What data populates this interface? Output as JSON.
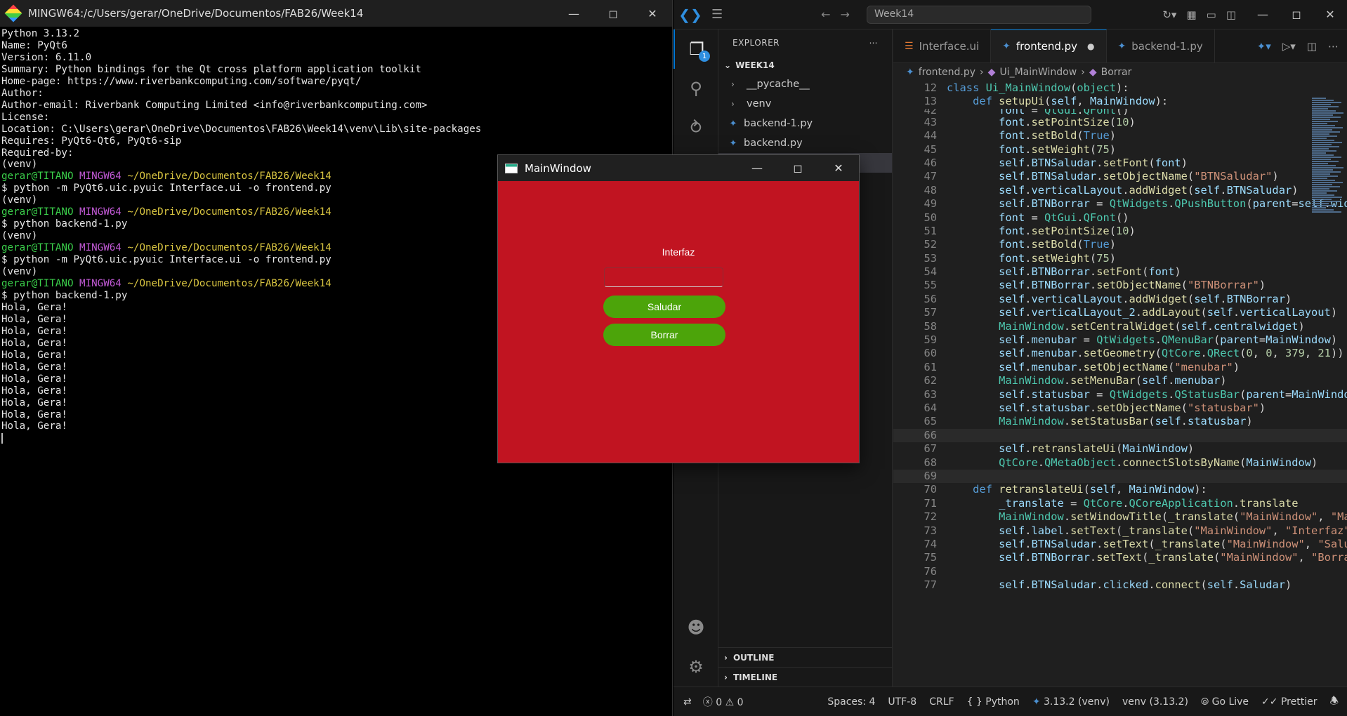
{
  "terminal": {
    "title": "MINGW64:/c/Users/gerar/OneDrive/Documentos/FAB26/Week14",
    "info_lines": [
      "Python 3.13.2",
      "Name: PyQt6",
      "Version: 6.11.0",
      "Summary: Python bindings for the Qt cross platform application toolkit",
      "Home-page: https://www.riverbankcomputing.com/software/pyqt/",
      "Author:",
      "Author-email: Riverbank Computing Limited <info@riverbankcomputing.com>",
      "License:",
      "Location: C:\\Users\\gerar\\OneDrive\\Documentos\\FAB26\\Week14\\venv\\Lib\\site-packages",
      "Requires: PyQt6-Qt6, PyQt6-sip",
      "Required-by:",
      "(venv)"
    ],
    "prompt_user": "gerar@TITANO",
    "prompt_shell": "MINGW64",
    "prompt_path": "~/OneDrive/Documentos/FAB26/Week14",
    "venv": "(venv)",
    "cmd1": "$ python -m PyQt6.uic.pyuic Interface.ui -o frontend.py",
    "cmd2": "$ python backend-1.py",
    "cmd3": "$ python -m PyQt6.uic.pyuic Interface.ui -o frontend.py",
    "cmd4": "$ python backend-1.py",
    "output_line": "Hola, Gera!",
    "output_count": 11
  },
  "vscode": {
    "search_text": "Week14",
    "explorer_label": "EXPLORER",
    "explorer_badge": "1",
    "folder": "WEEK14",
    "tree": [
      {
        "type": "folder",
        "label": "__pycache__"
      },
      {
        "type": "folder",
        "label": "venv"
      },
      {
        "type": "file",
        "label": "backend-1.py"
      },
      {
        "type": "file",
        "label": "backend.py"
      }
    ],
    "outline_label": "OUTLINE",
    "timeline_label": "TIMELINE",
    "tabs": [
      {
        "label": "Interface.ui",
        "active": false
      },
      {
        "label": "frontend.py",
        "active": true
      },
      {
        "label": "backend-1.py",
        "active": false
      }
    ],
    "breadcrumb": {
      "file": "frontend.py",
      "cls": "Ui_MainWindow",
      "method": "Borrar"
    },
    "status": {
      "errors": "0",
      "warnings": "0",
      "spaces": "Spaces: 4",
      "encoding": "UTF-8",
      "eol": "CRLF",
      "language": "Python",
      "interpreter": "3.13.2 (venv)",
      "env": "venv (3.13.2)",
      "golive": "Go Live",
      "prettier": "Prettier"
    }
  },
  "code_lines": [
    {
      "n": "12",
      "html": "<span class='kw'>class</span> <span class='cls'>Ui_MainWindow</span>(<span class='cls'>object</span>):",
      "cls": "sticky"
    },
    {
      "n": "13",
      "html": "    <span class='kw'>def</span> <span class='fn'>setupUi</span>(<span class='self'>self</span>, <span class='self'>MainWindow</span>):",
      "cls": "sticky"
    },
    {
      "n": "42",
      "html": "        <span class='self'>font</span> = <span class='cls'>QtGui</span>.<span class='cls'>QFont</span>()",
      "cls": "clip"
    },
    {
      "n": "43",
      "html": "        <span class='self'>font</span>.<span class='fn'>setPointSize</span>(<span class='num'>10</span>)"
    },
    {
      "n": "44",
      "html": "        <span class='self'>font</span>.<span class='fn'>setBold</span>(<span class='kw'>True</span>)"
    },
    {
      "n": "45",
      "html": "        <span class='self'>font</span>.<span class='fn'>setWeight</span>(<span class='num'>75</span>)"
    },
    {
      "n": "46",
      "html": "        <span class='self'>self</span>.<span class='self'>BTNSaludar</span>.<span class='fn'>setFont</span>(<span class='self'>font</span>)"
    },
    {
      "n": "47",
      "html": "        <span class='self'>self</span>.<span class='self'>BTNSaludar</span>.<span class='fn'>setObjectName</span>(<span class='str'>\"BTNSaludar\"</span>)"
    },
    {
      "n": "48",
      "html": "        <span class='self'>self</span>.<span class='self'>verticalLayout</span>.<span class='fn'>addWidget</span>(<span class='self'>self</span>.<span class='self'>BTNSaludar</span>)"
    },
    {
      "n": "49",
      "html": "        <span class='self'>self</span>.<span class='self'>BTNBorrar</span> = <span class='cls'>QtWidgets</span>.<span class='cls'>QPushButton</span>(<span class='self'>parent</span>=<span class='self'>self</span>.<span class='self'>widget</span>)"
    },
    {
      "n": "50",
      "html": "        <span class='self'>font</span> = <span class='cls'>QtGui</span>.<span class='cls'>QFont</span>()"
    },
    {
      "n": "51",
      "html": "        <span class='self'>font</span>.<span class='fn'>setPointSize</span>(<span class='num'>10</span>)"
    },
    {
      "n": "52",
      "html": "        <span class='self'>font</span>.<span class='fn'>setBold</span>(<span class='kw'>True</span>)"
    },
    {
      "n": "53",
      "html": "        <span class='self'>font</span>.<span class='fn'>setWeight</span>(<span class='num'>75</span>)"
    },
    {
      "n": "54",
      "html": "        <span class='self'>self</span>.<span class='self'>BTNBorrar</span>.<span class='fn'>setFont</span>(<span class='self'>font</span>)"
    },
    {
      "n": "55",
      "html": "        <span class='self'>self</span>.<span class='self'>BTNBorrar</span>.<span class='fn'>setObjectName</span>(<span class='str'>\"BTNBorrar\"</span>)"
    },
    {
      "n": "56",
      "html": "        <span class='self'>self</span>.<span class='self'>verticalLayout</span>.<span class='fn'>addWidget</span>(<span class='self'>self</span>.<span class='self'>BTNBorrar</span>)"
    },
    {
      "n": "57",
      "html": "        <span class='self'>self</span>.<span class='self'>verticalLayout_2</span>.<span class='fn'>addLayout</span>(<span class='self'>self</span>.<span class='self'>verticalLayout</span>)"
    },
    {
      "n": "58",
      "html": "        <span class='cls'>MainWindow</span>.<span class='fn'>setCentralWidget</span>(<span class='self'>self</span>.<span class='self'>centralwidget</span>)"
    },
    {
      "n": "59",
      "html": "        <span class='self'>self</span>.<span class='self'>menubar</span> = <span class='cls'>QtWidgets</span>.<span class='cls'>QMenuBar</span>(<span class='self'>parent</span>=<span class='self'>MainWindow</span>)"
    },
    {
      "n": "60",
      "html": "        <span class='self'>self</span>.<span class='self'>menubar</span>.<span class='fn'>setGeometry</span>(<span class='cls'>QtCore</span>.<span class='cls'>QRect</span>(<span class='num'>0</span>, <span class='num'>0</span>, <span class='num'>379</span>, <span class='num'>21</span>))"
    },
    {
      "n": "61",
      "html": "        <span class='self'>self</span>.<span class='self'>menubar</span>.<span class='fn'>setObjectName</span>(<span class='str'>\"menubar\"</span>)"
    },
    {
      "n": "62",
      "html": "        <span class='cls'>MainWindow</span>.<span class='fn'>setMenuBar</span>(<span class='self'>self</span>.<span class='self'>menubar</span>)"
    },
    {
      "n": "63",
      "html": "        <span class='self'>self</span>.<span class='self'>statusbar</span> = <span class='cls'>QtWidgets</span>.<span class='cls'>QStatusBar</span>(<span class='self'>parent</span>=<span class='self'>MainWindow</span>)"
    },
    {
      "n": "64",
      "html": "        <span class='self'>self</span>.<span class='self'>statusbar</span>.<span class='fn'>setObjectName</span>(<span class='str'>\"statusbar\"</span>)"
    },
    {
      "n": "65",
      "html": "        <span class='cls'>MainWindow</span>.<span class='fn'>setStatusBar</span>(<span class='self'>self</span>.<span class='self'>statusbar</span>)"
    },
    {
      "n": "66",
      "html": "",
      "cls": "hl"
    },
    {
      "n": "67",
      "html": "        <span class='self'>self</span>.<span class='fn'>retranslateUi</span>(<span class='self'>MainWindow</span>)"
    },
    {
      "n": "68",
      "html": "        <span class='cls'>QtCore</span>.<span class='cls'>QMetaObject</span>.<span class='fn'>connectSlotsByName</span>(<span class='self'>MainWindow</span>)"
    },
    {
      "n": "69",
      "html": "",
      "cls": "hl"
    },
    {
      "n": "70",
      "html": "    <span class='kw'>def</span> <span class='fn'>retranslateUi</span>(<span class='self'>self</span>, <span class='self'>MainWindow</span>):"
    },
    {
      "n": "71",
      "html": "        <span class='self'>_translate</span> = <span class='cls'>QtCore</span>.<span class='cls'>QCoreApplication</span>.<span class='fn'>translate</span>"
    },
    {
      "n": "72",
      "html": "        <span class='cls'>MainWindow</span>.<span class='fn'>setWindowTitle</span>(<span class='fn'>_translate</span>(<span class='str'>\"MainWindow\"</span>, <span class='str'>\"MainWindow\"</span>))"
    },
    {
      "n": "73",
      "html": "        <span class='self'>self</span>.<span class='self'>label</span>.<span class='fn'>setText</span>(<span class='fn'>_translate</span>(<span class='str'>\"MainWindow\"</span>, <span class='str'>\"Interfaz\"</span>))"
    },
    {
      "n": "74",
      "html": "        <span class='self'>self</span>.<span class='self'>BTNSaludar</span>.<span class='fn'>setText</span>(<span class='fn'>_translate</span>(<span class='str'>\"MainWindow\"</span>, <span class='str'>\"Saludar\"</span>))"
    },
    {
      "n": "75",
      "html": "        <span class='self'>self</span>.<span class='self'>BTNBorrar</span>.<span class='fn'>setText</span>(<span class='fn'>_translate</span>(<span class='str'>\"MainWindow\"</span>, <span class='str'>\"Borrar\"</span>))"
    },
    {
      "n": "76",
      "html": ""
    },
    {
      "n": "77",
      "html": "        <span class='self'>self</span>.<span class='self'>BTNSaludar</span>.<span class='self'>clicked</span>.<span class='fn'>connect</span>(<span class='self'>self</span>.<span class='self'>Saludar</span>)"
    }
  ],
  "qt": {
    "title": "MainWindow",
    "label": "Interfaz",
    "input_value": "",
    "btn_saludar": "Saludar",
    "btn_borrar": "Borrar",
    "bg_color": "#c11421",
    "btn_color": "#4ca40a"
  }
}
